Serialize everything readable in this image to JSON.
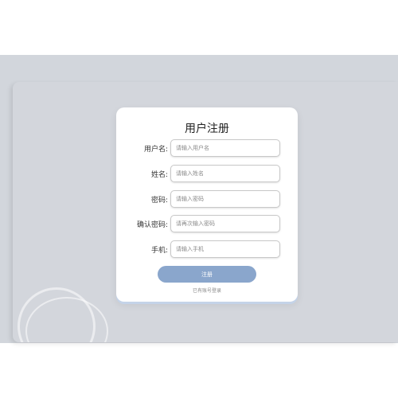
{
  "form": {
    "title": "用户注册",
    "fields": [
      {
        "label": "用户名:",
        "placeholder": "请输入用户名"
      },
      {
        "label": "姓名:",
        "placeholder": "请输入姓名"
      },
      {
        "label": "密码:",
        "placeholder": "请输入密码"
      },
      {
        "label": "确认密码:",
        "placeholder": "请再次输入密码"
      },
      {
        "label": "手机:",
        "placeholder": "请输入手机"
      }
    ],
    "submit_label": "注册",
    "login_link": "已有账号登录"
  },
  "colors": {
    "background_band": "#d2d6dc",
    "card": "#ffffff",
    "submit_button": "#8aa6cc",
    "card_shadow_accent": "#c4d3e8"
  }
}
